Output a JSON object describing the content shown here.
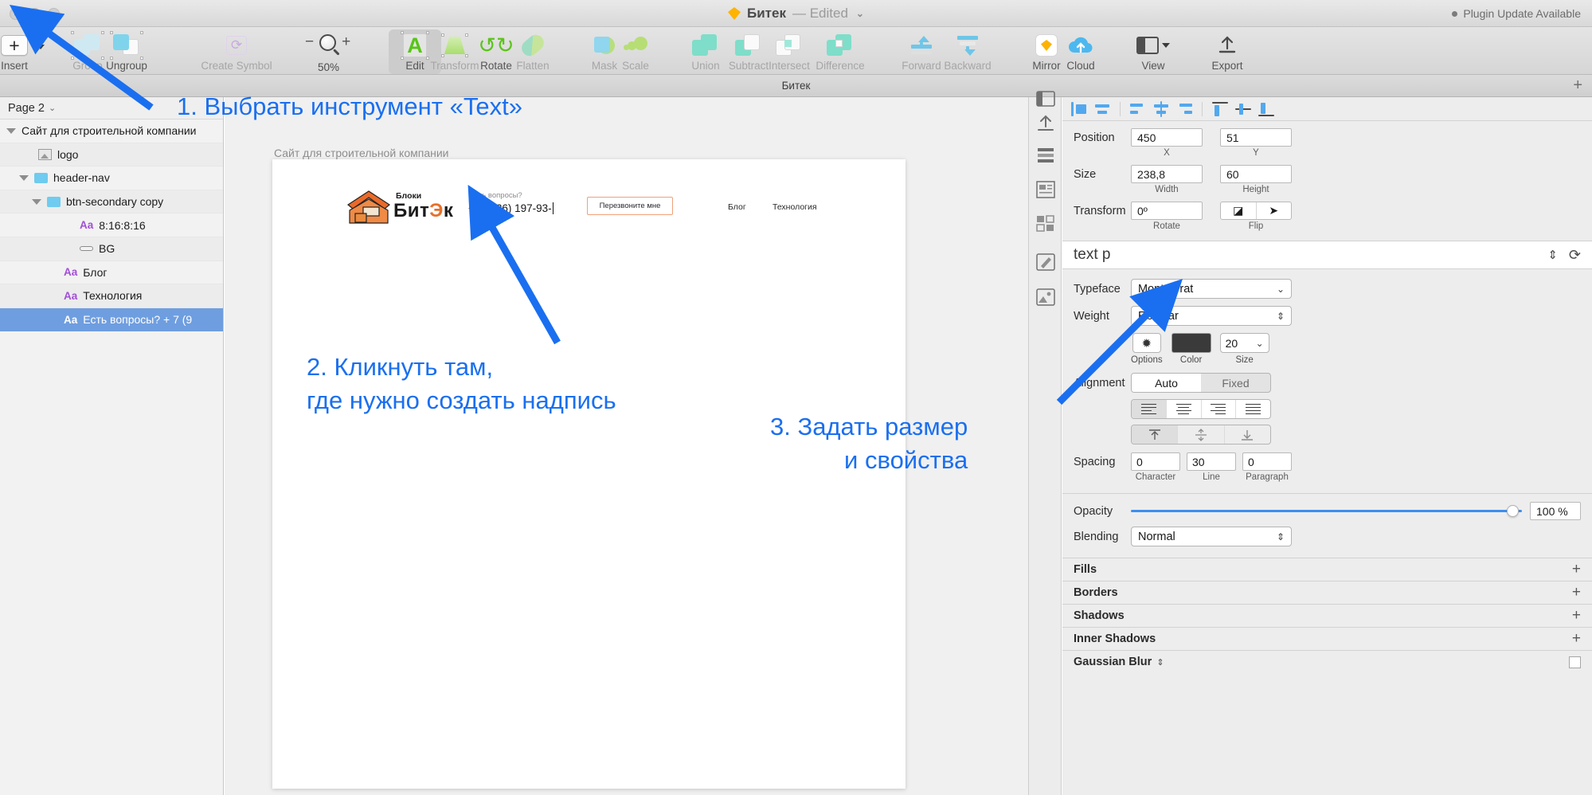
{
  "titlebar": {
    "document_name": "Битек",
    "edited_label": "— Edited",
    "chevron": "⌄",
    "plugin_notice": "Plugin Update Available"
  },
  "toolbar": {
    "items": [
      {
        "label": "Insert",
        "icon": "plus-icon",
        "enabled": true
      },
      {
        "label": "Group",
        "icon": "group-icon",
        "enabled": false
      },
      {
        "label": "Ungroup",
        "icon": "ungroup-icon",
        "enabled": true
      },
      {
        "label": "Create Symbol",
        "icon": "create-symbol-icon",
        "enabled": false
      },
      {
        "label": "Edit",
        "icon": "edit-text-icon",
        "enabled": true
      },
      {
        "label": "Transform",
        "icon": "transform-icon",
        "enabled": false
      },
      {
        "label": "Rotate",
        "icon": "rotate-icon",
        "enabled": true
      },
      {
        "label": "Flatten",
        "icon": "flatten-icon",
        "enabled": false
      },
      {
        "label": "Mask",
        "icon": "mask-icon",
        "enabled": false
      },
      {
        "label": "Scale",
        "icon": "scale-icon",
        "enabled": false
      },
      {
        "label": "Union",
        "icon": "union-icon",
        "enabled": false
      },
      {
        "label": "Subtract",
        "icon": "subtract-icon",
        "enabled": false
      },
      {
        "label": "Intersect",
        "icon": "intersect-icon",
        "enabled": false
      },
      {
        "label": "Difference",
        "icon": "difference-icon",
        "enabled": false
      },
      {
        "label": "Forward",
        "icon": "forward-icon",
        "enabled": false
      },
      {
        "label": "Backward",
        "icon": "backward-icon",
        "enabled": false
      },
      {
        "label": "Mirror",
        "icon": "mirror-icon",
        "enabled": true
      },
      {
        "label": "Cloud",
        "icon": "cloud-upload-icon",
        "enabled": true
      },
      {
        "label": "View",
        "icon": "view-icon",
        "enabled": true
      },
      {
        "label": "Export",
        "icon": "export-icon",
        "enabled": true
      }
    ],
    "zoom_level": "50%",
    "zoom_minus": "−",
    "zoom_plus": "+"
  },
  "docbar": {
    "tab_name": "Битек",
    "add_tab": "+"
  },
  "sidebar": {
    "page_name": "Page 2",
    "page_chevron": "⌄",
    "layers": [
      {
        "name": "Сайт для строительной компании",
        "icon": "artboard-disclosure-icon",
        "indent": 0,
        "type": "artboard"
      },
      {
        "name": "logo",
        "icon": "image-layer-icon",
        "indent": 1,
        "type": "image"
      },
      {
        "name": "header-nav",
        "icon": "folder-icon",
        "indent": 1,
        "type": "group"
      },
      {
        "name": "btn-secondary copy",
        "icon": "folder-icon",
        "indent": 2,
        "type": "group"
      },
      {
        "name": "8:16:8:16",
        "icon": "text-layer-icon",
        "indent": 3,
        "type": "text"
      },
      {
        "name": "BG",
        "icon": "shape-layer-icon",
        "indent": 3,
        "type": "shape"
      },
      {
        "name": "Блог",
        "icon": "text-layer-icon",
        "indent": 2,
        "type": "text"
      },
      {
        "name": "Технология",
        "icon": "text-layer-icon",
        "indent": 2,
        "type": "text"
      },
      {
        "name": "Есть вопросы? + 7 (9",
        "icon": "text-layer-icon",
        "indent": 2,
        "type": "text",
        "selected": true
      }
    ]
  },
  "canvas": {
    "artboard_name": "Сайт для строительной компании",
    "site": {
      "logo_small_text": "Блоки",
      "logo_main_text": "БитЭк",
      "question_label": "Есть вопросы?",
      "phone": "+ 7 (926) 197-93-",
      "cta_label": "Перезвоните мне",
      "nav": [
        "Блог",
        "Технология"
      ]
    }
  },
  "annotations": {
    "step1": "1. Выбрать инструмент «Text»",
    "step2_line1": "2. Кликнуть там,",
    "step2_line2": "где нужно создать надпись",
    "step3_line1": "3. Задать размер",
    "step3_line2": "и свойства",
    "color": "#1a6ff0"
  },
  "inspector": {
    "position": {
      "label": "Position",
      "x": "450",
      "y": "51",
      "x_cap": "X",
      "y_cap": "Y"
    },
    "size": {
      "label": "Size",
      "width": "238,8",
      "height": "60",
      "w_cap": "Width",
      "h_cap": "Height"
    },
    "transform": {
      "label": "Transform",
      "rotate": "0º",
      "rotate_cap": "Rotate",
      "flip_cap": "Flip"
    },
    "text_style": {
      "name": "text p"
    },
    "typeface": {
      "label": "Typeface",
      "value": "Montserrat"
    },
    "weight": {
      "label": "Weight",
      "value": "Regular"
    },
    "options_cap": "Options",
    "color_cap": "Color",
    "color_value": "#3a3a3a",
    "size_cap": "Size",
    "font_size": "20",
    "alignment": {
      "label": "Alignment",
      "auto": "Auto",
      "fixed": "Fixed"
    },
    "spacing": {
      "label": "Spacing",
      "character": "0",
      "line": "30",
      "paragraph": "0",
      "character_cap": "Character",
      "line_cap": "Line",
      "paragraph_cap": "Paragraph"
    },
    "opacity": {
      "label": "Opacity",
      "value": "100 %"
    },
    "blending": {
      "label": "Blending",
      "value": "Normal"
    },
    "sections": [
      {
        "title": "Fills",
        "control": "plus"
      },
      {
        "title": "Borders",
        "control": "plus"
      },
      {
        "title": "Shadows",
        "control": "plus"
      },
      {
        "title": "Inner Shadows",
        "control": "plus"
      },
      {
        "title": "Gaussian Blur",
        "control": "checkbox"
      }
    ]
  }
}
